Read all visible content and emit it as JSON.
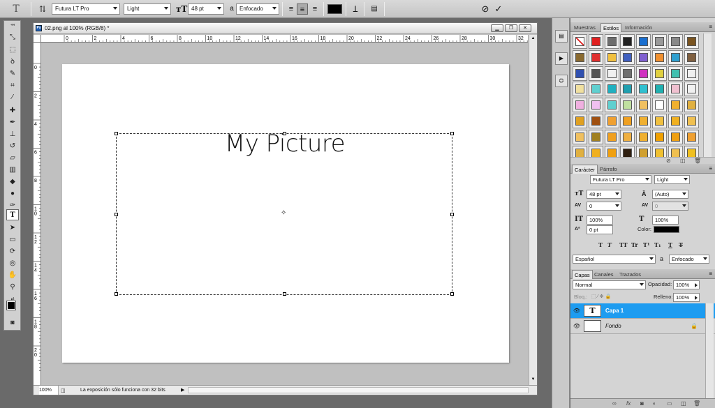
{
  "options_bar": {
    "tool_icon": "T",
    "font_family": "Futura LT Pro",
    "font_style": "Light",
    "font_size": "48 pt",
    "aa_label": "a",
    "antialias": "Enfocado",
    "icons": [
      "type-tool-preset-icon",
      "orientation-icon",
      "align-left-icon",
      "align-center-icon",
      "align-right-icon",
      "text-color-swatch",
      "warp-text-icon",
      "character-panel-icon",
      "cancel-icon",
      "commit-icon"
    ],
    "text_color": "#000000"
  },
  "document": {
    "title": "02.png al 100% (RGB/8) *",
    "ruler_labels": [
      "0",
      "2",
      "4",
      "6",
      "8",
      "10",
      "12",
      "14",
      "16",
      "18",
      "20",
      "22",
      "24",
      "26",
      "28",
      "30",
      "32"
    ],
    "vruler_labels": [
      "0",
      "2",
      "4",
      "6",
      "8",
      "1 0",
      "1 2",
      "1 4",
      "1 6",
      "1 8",
      "2 0"
    ],
    "canvas_text": "My Picture",
    "zoom": "100%",
    "status": "La exposición sólo funciona con 32 bits"
  },
  "styles_panel": {
    "tabs": [
      "Muestras",
      "Estilos",
      "Información"
    ],
    "active_tab": "Estilos",
    "swatch_colors": [
      "#ffffff",
      "#e02020",
      "#6d6d6d",
      "#222222",
      "#1a6fd0",
      "#9a9a9a",
      "#8a8a8a",
      "#7a5420",
      "#8a6a30",
      "#e03030",
      "#f0c040",
      "#4060c0",
      "#8060d0",
      "#f09030",
      "#30a0d0",
      "#806040",
      "#3050b0",
      "#555555",
      "#f0f0f0",
      "#707070",
      "#d030c0",
      "#e0d040",
      "#40c0b0",
      "#f0f0f0",
      "#f0e0a0",
      "#60d0d0",
      "#20b0c0",
      "#20a0b0",
      "#30c0d0",
      "#20b0b0",
      "#f0c0d0",
      "#f0f0f0",
      "#f0b0e0",
      "#f0c0f0",
      "#60d0d0",
      "#c0e0a0",
      "#f0c060",
      "#ffffff",
      "#f0b030",
      "#e0b040",
      "#e0a020",
      "#a05010",
      "#f0a030",
      "#f0a020",
      "#f0b030",
      "#f0c040",
      "#f0b020",
      "#f0c050",
      "#f0c060",
      "#a08020",
      "#f0a020",
      "#f0b040",
      "#f0b030",
      "#f0a000",
      "#f0a010",
      "#f0a030",
      "#e0b040",
      "#f0b020",
      "#f0a010",
      "#302010",
      "#d0a030",
      "#f0c030",
      "#f0c050",
      "#f0c020"
    ]
  },
  "character_panel": {
    "tabs": [
      "Carácter",
      "Párrafo"
    ],
    "active_tab": "Carácter",
    "font_family": "Futura LT Pro",
    "font_style": "Light",
    "size": "48 pt",
    "leading": "(Auto)",
    "kerning": "0",
    "tracking": "0",
    "vertical_scale": "100%",
    "horizontal_scale": "100%",
    "baseline_shift": "0 pt",
    "color_label": "Color:",
    "color": "#000000",
    "format_buttons": [
      "T",
      "T",
      "TT",
      "Tr",
      "T¹",
      "T₁",
      "T",
      "T"
    ],
    "language": "Español",
    "aa_label": "a",
    "antialias": "Enfocado"
  },
  "layers_panel": {
    "tabs": [
      "Capas",
      "Canales",
      "Trazados"
    ],
    "active_tab": "Capas",
    "blend_mode": "Normal",
    "opacity_label": "Opacidad:",
    "opacity": "100%",
    "lock_label": "Bloq.:",
    "fill_label": "Relleno:",
    "fill": "100%",
    "layers": [
      {
        "name": "Capa 1",
        "thumb": "T",
        "selected": true,
        "locked": false
      },
      {
        "name": "Fondo",
        "thumb": "",
        "selected": false,
        "locked": true
      }
    ],
    "footer_icons": [
      "link-icon",
      "fx-icon",
      "mask-icon",
      "adjustment-icon",
      "group-icon",
      "new-layer-icon",
      "trash-icon"
    ]
  },
  "toolbox": {
    "tools": [
      "move-tool",
      "marquee-tool",
      "lasso-tool",
      "quick-select-tool",
      "crop-tool",
      "eyedropper-tool",
      "healing-tool",
      "brush-tool",
      "stamp-tool",
      "history-brush-tool",
      "eraser-tool",
      "gradient-tool",
      "blur-tool",
      "dodge-tool",
      "pen-tool",
      "type-tool",
      "path-select-tool",
      "shape-tool",
      "3d-rotate-tool",
      "3d-orbit-tool",
      "hand-tool",
      "zoom-tool"
    ],
    "active_tool": "type-tool"
  }
}
